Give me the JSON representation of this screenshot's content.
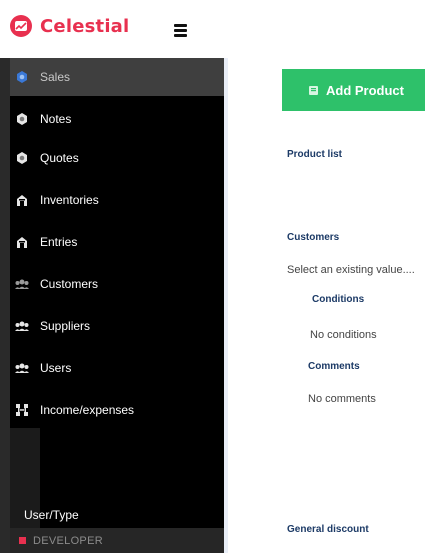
{
  "brand": {
    "name": "Celestial",
    "color": "#e8304f"
  },
  "sidebar": {
    "items": [
      {
        "label": "Sales",
        "icon": "sales-icon",
        "active": true
      },
      {
        "label": "Notes",
        "icon": "notes-icon"
      },
      {
        "label": "Quotes",
        "icon": "quotes-icon"
      },
      {
        "label": "Inventories",
        "icon": "inventories-icon"
      },
      {
        "label": "Entries",
        "icon": "entries-icon"
      },
      {
        "label": "Customers",
        "icon": "customers-icon"
      },
      {
        "label": "Suppliers",
        "icon": "suppliers-icon"
      },
      {
        "label": "Users",
        "icon": "users-icon"
      },
      {
        "label": "Income/expenses",
        "icon": "income-expenses-icon"
      }
    ],
    "user_type_label": "User/Type",
    "developer_label": "DEVELOPER"
  },
  "main": {
    "add_product_label": "Add Product",
    "product_list_label": "Product list",
    "customers_label": "Customers",
    "customers_placeholder": "Select an existing value....",
    "conditions_label": "Conditions",
    "conditions_value": "No conditions",
    "comments_label": "Comments",
    "comments_value": "No comments",
    "general_discount_label": "General discount"
  },
  "colors": {
    "accent": "#e8304f",
    "button_green": "#2ec16a",
    "sidebar_bg": "#000000",
    "active_item_bg": "#3f3f3f",
    "label_navy": "#1c3a66"
  }
}
